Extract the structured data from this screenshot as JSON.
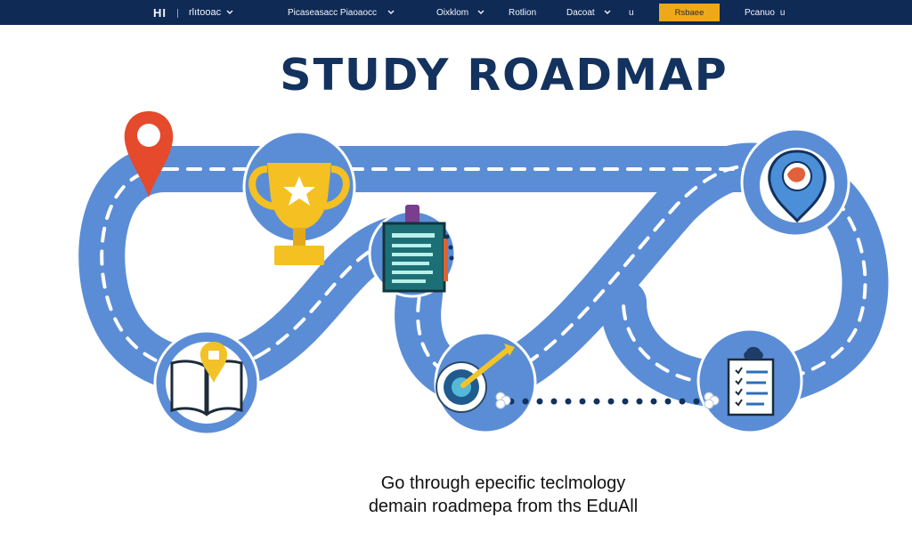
{
  "nav": {
    "logo": "HI",
    "brand": "rlıtooac",
    "item1": "Picaseasacc Piaoaocc",
    "item2": "Oixklom",
    "item3": "Rotlion",
    "item4": "Dacoat",
    "item5": "u",
    "cta": "Rsbaee",
    "item6": "Pcanuo",
    "item6_suffix": "u"
  },
  "title": "STUDY ROADMAP",
  "subtitle": {
    "line1": "Go through epecific teclmology",
    "line2": "demain roadmepa from ths EduAll"
  },
  "colors": {
    "navbar": "#0e2a55",
    "cta": "#f0a81b",
    "road": "#5b8dd6",
    "title": "#13325e"
  },
  "icons": [
    "location-pin-icon",
    "trophy-icon",
    "clipboard-checklist-icon",
    "map-pin-globe-icon",
    "open-book-icon",
    "target-dart-icon",
    "checklist-icon"
  ]
}
